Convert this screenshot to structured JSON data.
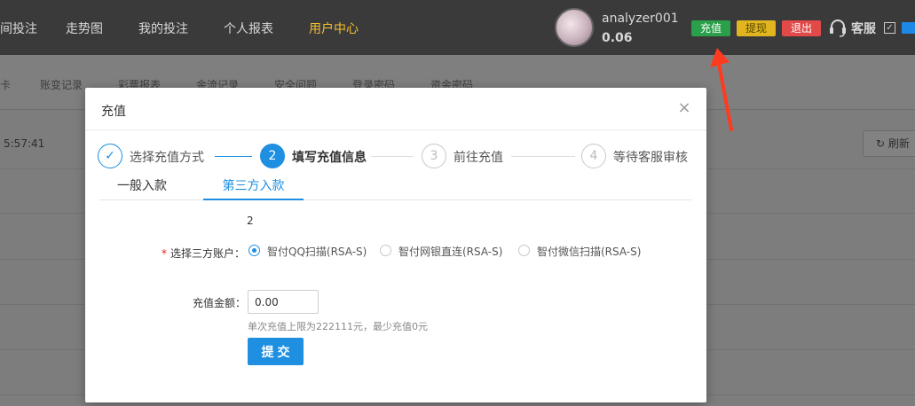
{
  "nav": {
    "items": [
      "间投注",
      "走势图",
      "我的投注",
      "个人报表",
      "用户中心"
    ],
    "user": {
      "name": "analyzer001",
      "balance": "0.06"
    },
    "buttons": {
      "recharge": "充值",
      "withdraw": "提现",
      "logout": "退出"
    },
    "service": "客服"
  },
  "subnav": {
    "items": [
      "卡",
      "账变记录",
      "彩票报表",
      "金流记录",
      "安全问题",
      "登录密码",
      "资金密码"
    ]
  },
  "page": {
    "time": "5:57:41",
    "refresh": "刷新"
  },
  "modal": {
    "title": "充值",
    "close": "×",
    "steps": [
      {
        "num": "✓",
        "label": "选择充值方式"
      },
      {
        "num": "2",
        "label": "填写充值信息"
      },
      {
        "num": "3",
        "label": "前往充值"
      },
      {
        "num": "4",
        "label": "等待客服审核"
      }
    ],
    "tabs": [
      "一般入款",
      "第三方入款"
    ],
    "number": "2",
    "account_label": "选择三方账户：",
    "required_mark": "*",
    "options": [
      "智付QQ扫描(RSA-S)",
      "智付网银直连(RSA-S)",
      "智付微信扫描(RSA-S)"
    ],
    "amount_label": "充值金额：",
    "amount_value": "0.00",
    "hint": "单次充值上限为222111元，最少充值0元",
    "submit": "提交"
  },
  "colors": {
    "accent": "#1e8fe1",
    "recharge": "#2aa04a",
    "withdraw": "#e0b51f",
    "logout": "#e24a4a",
    "arrow": "#ff3b1f"
  },
  "icons": {
    "close": "close-icon",
    "headset": "headset-icon",
    "check": "check-icon",
    "refresh": "refresh-icon"
  }
}
